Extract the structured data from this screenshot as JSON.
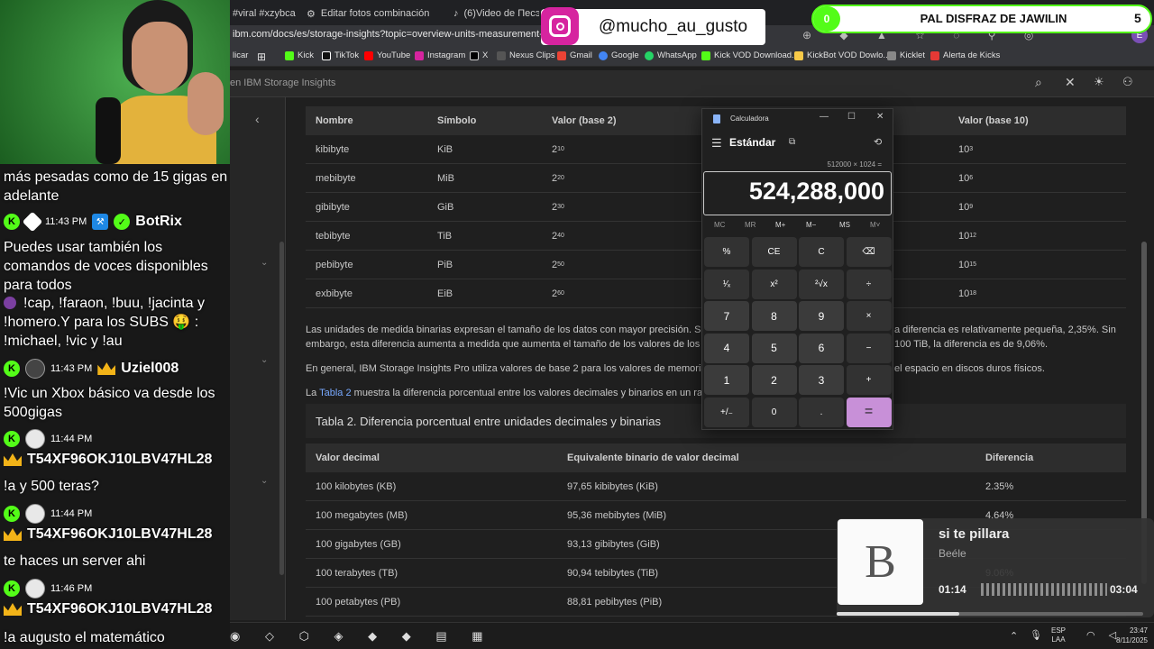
{
  "browser": {
    "tabs": [
      "#viral #xzybca #",
      "Editar fotos combinación",
      "(6)Video de Песэх Цеса"
    ],
    "url": "ibm.com/docs/es/storage-insights?topic=overview-units-measurement-stora",
    "bookmarks": [
      "licar",
      "Kick",
      "TikTok",
      "YouTube",
      "Instagram",
      "X",
      "Nexus Clips",
      "Gmail",
      "Google",
      "WhatsApp",
      "Kick VOD Download...",
      "KickBot VOD Dowlo...",
      "Kicklet",
      "Alerta de Kicks"
    ],
    "search_placeholder": "en IBM Storage Insights"
  },
  "table1": {
    "headers": [
      "Nombre",
      "Símbolo",
      "Valor (base 2)",
      "Valor (base 10)"
    ],
    "rows": [
      {
        "name": "kibibyte",
        "symbol": "KiB",
        "base2": "2",
        "exp2": "10",
        "base10": "10",
        "exp10": "3"
      },
      {
        "name": "mebibyte",
        "symbol": "MiB",
        "base2": "2",
        "exp2": "20",
        "base10": "10",
        "exp10": "6"
      },
      {
        "name": "gibibyte",
        "symbol": "GiB",
        "base2": "2",
        "exp2": "30",
        "base10": "10",
        "exp10": "9"
      },
      {
        "name": "tebibyte",
        "symbol": "TiB",
        "base2": "2",
        "exp2": "40",
        "base10": "10",
        "exp10": "12"
      },
      {
        "name": "pebibyte",
        "symbol": "PiB",
        "base2": "2",
        "exp2": "50",
        "base10": "10",
        "exp10": "15"
      },
      {
        "name": "exbibyte",
        "symbol": "EiB",
        "base2": "2",
        "exp2": "60",
        "base10": "10",
        "exp10": "18"
      }
    ]
  },
  "paragraphs": {
    "p1a": "Las unidades de medida binarias expresan el tamaño de los datos con mayor precisión. Si se",
    "p1b": "a diferencia es relativamente pequeña, 2,35%. Sin",
    "p2a": "embargo, esta diferencia aumenta a medida que aumenta el tamaño de los valores de los da",
    "p2b": "100 TiB, la diferencia es de 9,06%.",
    "p3a": "En general, IBM Storage Insights Pro utiliza valores de base 2 para los valores de memoria y",
    "p3b": "el espacio en discos duros físicos.",
    "p4_prefix": "La",
    "p4_link": "Tabla 2",
    "p4_rest": "muestra la diferencia porcentual entre los valores decimales y binarios en un rang"
  },
  "table2": {
    "caption": "Tabla 2. Diferencia porcentual entre unidades decimales y binarias",
    "headers": [
      "Valor decimal",
      "Equivalente binario de valor decimal",
      "Diferencia"
    ],
    "rows": [
      {
        "dec": "100 kilobytes (KB)",
        "bin": "97,65 kibibytes (KiB)",
        "diff": "2.35%"
      },
      {
        "dec": "100 megabytes (MB)",
        "bin": "95,36 mebibytes (MiB)",
        "diff": "4.64%"
      },
      {
        "dec": "100 gigabytes (GB)",
        "bin": "93,13 gibibytes (GiB)",
        "diff": ""
      },
      {
        "dec": "100 terabytes (TB)",
        "bin": "90,94 tebibytes (TiB)",
        "diff": "9.06%"
      },
      {
        "dec": "100 petabytes (PB)",
        "bin": "88,81 pebibytes (PiB)",
        "diff": ""
      }
    ]
  },
  "calculator": {
    "title": "Calculadora",
    "mode": "Estándar",
    "expression": "512000 × 1024 =",
    "display": "524,288,000",
    "memory": [
      "MC",
      "MR",
      "M+",
      "M−",
      "MS",
      "M˅"
    ],
    "keys": [
      [
        "%",
        "CE",
        "C",
        "⌫"
      ],
      [
        "¹⁄ₓ",
        "x²",
        "²√x",
        "÷"
      ],
      [
        "7",
        "8",
        "9",
        "×"
      ],
      [
        "4",
        "5",
        "6",
        "−"
      ],
      [
        "1",
        "2",
        "3",
        "+"
      ],
      [
        "+/₋",
        "0",
        ".",
        "="
      ]
    ]
  },
  "overlay": {
    "instagram_handle": "@mucho_au_gusto",
    "goal": {
      "current": "0",
      "label": "PAL DISFRAZ DE JAWILIN",
      "target": "5"
    },
    "music": {
      "title": "si te pillara",
      "artist": "Beéle",
      "elapsed": "01:14",
      "total": "03:04",
      "progress": 0.4
    }
  },
  "chat": {
    "m0": "más pesadas como de 15 gigas en adelante",
    "m1_time": "11:43 PM",
    "m1_user": "BotRix",
    "m1_text": "Puedes usar también los comandos de voces disponibles para todos",
    "m1_cmds": "!cap, !faraon, !buu, !jacinta y !homero.Y para los SUBS 🤑 : !michael, !vic y !au",
    "m2_time": "11:43 PM",
    "m2_user": "Uziel008",
    "m2_text": "!Vic un Xbox básico va desde los 500gigas",
    "m3_time": "11:44 PM",
    "m3_user": "T54XF96OKJ10LBV47HL28",
    "m3_text": "!a y 500 teras?",
    "m4_time": "11:44 PM",
    "m4_user": "T54XF96OKJ10LBV47HL28",
    "m4_text": "te haces un server ahi",
    "m5_time": "11:46 PM",
    "m5_user": "T54XF96OKJ10LBV47HL28",
    "m5_text": "!a augusto el matemático"
  },
  "taskbar": {
    "lang": "ESP",
    "layout": "LAA",
    "time": "23:47",
    "date": "8/11/2025"
  },
  "colors": {
    "kick_green": "#53fc18",
    "accent_purple": "#c890d8",
    "link": "#78a9ff"
  }
}
